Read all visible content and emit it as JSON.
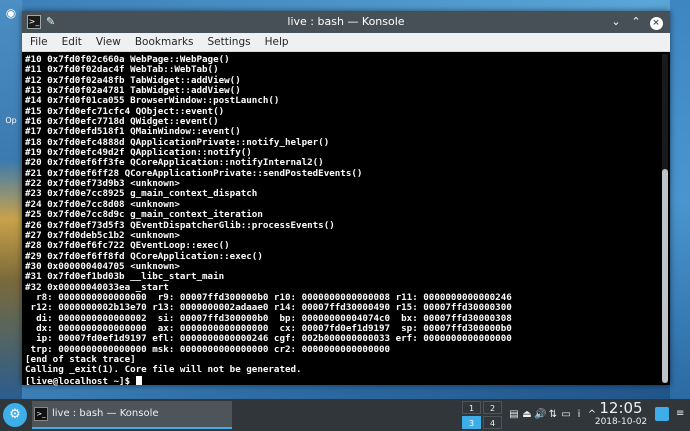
{
  "desktop": {
    "left_icon_glyph": "◉",
    "left_label": "Op"
  },
  "window": {
    "title": "live : bash — Konsole",
    "app_icon": "konsole-icon",
    "controls": {
      "minimize": "⌄",
      "maximize": "⌃",
      "close": "×"
    }
  },
  "menu": [
    "File",
    "Edit",
    "View",
    "Bookmarks",
    "Settings",
    "Help"
  ],
  "terminal": {
    "lines": [
      "#10 0x7fd0f02c660a WebPage::WebPage()",
      "#11 0x7fd0f02dac4f WebTab::WebTab()",
      "#12 0x7fd0f02a48fb TabWidget::addView()",
      "#13 0x7fd0f02a4781 TabWidget::addView()",
      "#14 0x7fd0f01ca055 BrowserWindow::postLaunch()",
      "#15 0x7fd0efc71cfc4 QObject::event()",
      "#16 0x7fd0efc7718d QWidget::event()",
      "#17 0x7fd0efd518f1 QMainWindow::event()",
      "#18 0x7fd0efc4888d QApplicationPrivate::notify_helper()",
      "#19 0x7fd0efc49d2f QApplication::notify()",
      "#20 0x7fd0ef6ff3fe QCoreApplication::notifyInternal2()",
      "#21 0x7fd0ef6ff28 QCoreApplicationPrivate::sendPostedEvents()",
      "#22 0x7fd0ef73d9b3 <unknown>",
      "#23 0x7fd0e7cc8925 g_main_context_dispatch",
      "#24 0x7fd0e7cc8d08 <unknown>",
      "#25 0x7fd0e7cc8d9c g_main_context_iteration",
      "#26 0x7fd0ef73d5f3 QEventDispatcherGlib::processEvents()",
      "#27 0x7fd0deb5c1b2 <unknown>",
      "#28 0x7fd0ef6fc722 QEventLoop::exec()",
      "#29 0x7fd0ef6ff8fd QCoreApplication::exec()",
      "#30 0x000000404705 <unknown>",
      "#31 0x7fd0ef1bd03b __libc_start_main",
      "#32 0x00000040033ea _start",
      "  r8: 0000000000000000  r9: 00007ffd300000b0 r10: 0000000000000008 r11: 0000000000000246",
      " r12: 0000000002b13e70 r13: 0000000002adaae0 r14: 00007ffd30000490 r15: 00007ffd30000300",
      "  di: 0000000000000002  si: 00007ffd300000b0  bp: 00000000004074c0  bx: 00007ffd30000308",
      "  dx: 0000000000000000  ax: 0000000000000000  cx: 00007fd0ef1d9197  sp: 00007ffd300000b0",
      "  ip: 00007fd0ef1d9197 efl: 0000000000000246 cgf: 002b000000000033 erf: 0000000000000000",
      " trp: 0000000000000000 msk: 0000000000000000 cr2: 0000000000000000",
      "[end of stack trace]",
      "Calling _exit(1). Core file will not be generated."
    ],
    "prompt": "[live@localhost ~]$ "
  },
  "taskbar": {
    "launcher_icon": "kde-launcher-icon",
    "task_label": "live : bash — Konsole",
    "pager": [
      "1",
      "2",
      "3",
      "4"
    ],
    "tray_icons": [
      "clipboard-icon",
      "usb-icon",
      "volume-icon",
      "network-icon",
      "battery-icon",
      "notifications-icon",
      "expand-arrow-icon"
    ],
    "tray_glyphs": [
      "▤",
      "⏏",
      "🔊",
      "⇅",
      "▭",
      "i",
      "^"
    ],
    "time": "12:05",
    "date": "2018-10-02",
    "menu_glyph": "≡"
  },
  "colors": {
    "accent": "#3daee9",
    "titlebar": "#475057",
    "panel": "#31363b",
    "terminal_bg": "#000000",
    "terminal_fg": "#fcfcfc"
  }
}
